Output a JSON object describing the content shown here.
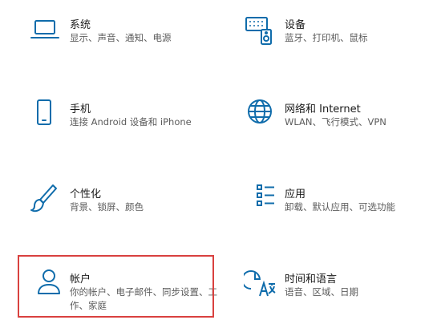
{
  "colors": {
    "icon": "#0f6cab",
    "selection_border": "#d9413f"
  },
  "tiles": [
    {
      "id": "system",
      "icon": "laptop-icon",
      "title": "系统",
      "desc": "显示、声音、通知、电源"
    },
    {
      "id": "devices",
      "icon": "keyboard-speaker-icon",
      "title": "设备",
      "desc": "蓝牙、打印机、鼠标"
    },
    {
      "id": "phone",
      "icon": "phone-icon",
      "title": "手机",
      "desc": "连接 Android 设备和 iPhone"
    },
    {
      "id": "network",
      "icon": "globe-icon",
      "title": "网络和 Internet",
      "desc": "WLAN、飞行模式、VPN"
    },
    {
      "id": "personalization",
      "icon": "brush-icon",
      "title": "个性化",
      "desc": "背景、锁屏、颜色"
    },
    {
      "id": "apps",
      "icon": "list-icon",
      "title": "应用",
      "desc": "卸载、默认应用、可选功能"
    },
    {
      "id": "accounts",
      "icon": "person-icon",
      "title": "帐户",
      "desc": "你的帐户、电子邮件、同步设置、工作、家庭"
    },
    {
      "id": "time-language",
      "icon": "clock-language-icon",
      "title": "时间和语言",
      "desc": "语音、区域、日期"
    }
  ]
}
